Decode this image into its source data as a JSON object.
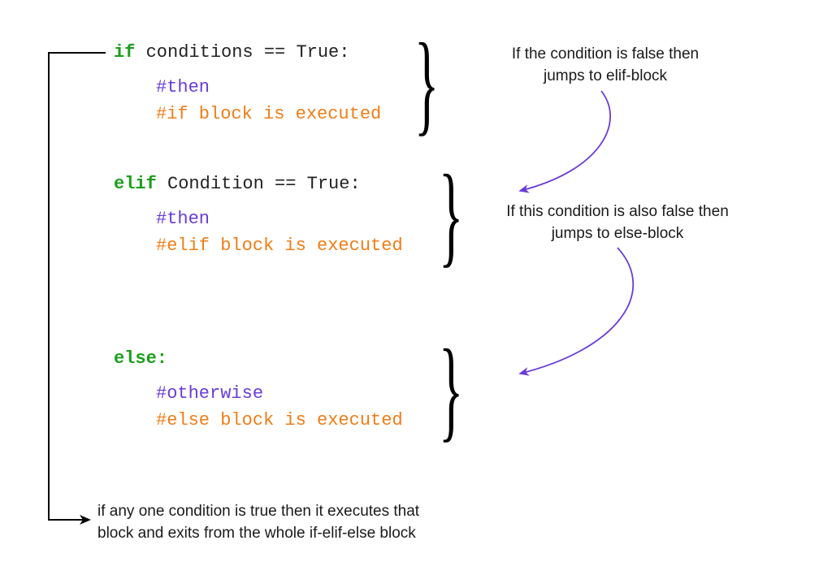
{
  "code": {
    "if_kw": "if",
    "if_cond": " conditions == True:",
    "if_c1": "#then",
    "if_c2": "#if block is executed",
    "elif_kw": "elif",
    "elif_cond": " Condition == True:",
    "elif_c1": "#then",
    "elif_c2": "#elif block is executed",
    "else_kw": "else:",
    "else_c1": "#otherwise",
    "else_c2": "#else block is executed"
  },
  "annot": {
    "a1_l1": "If the condition is false then",
    "a1_l2": "jumps to elif-block",
    "a2_l1": "If this condition is also false then",
    "a2_l2": "jumps to else-block",
    "a3_l1": "if any one condition is true then it executes that",
    "a3_l2": "block and exits from the whole if-elif-else block"
  },
  "braces": {
    "b1": "}",
    "b2": "}",
    "b3": "}"
  }
}
